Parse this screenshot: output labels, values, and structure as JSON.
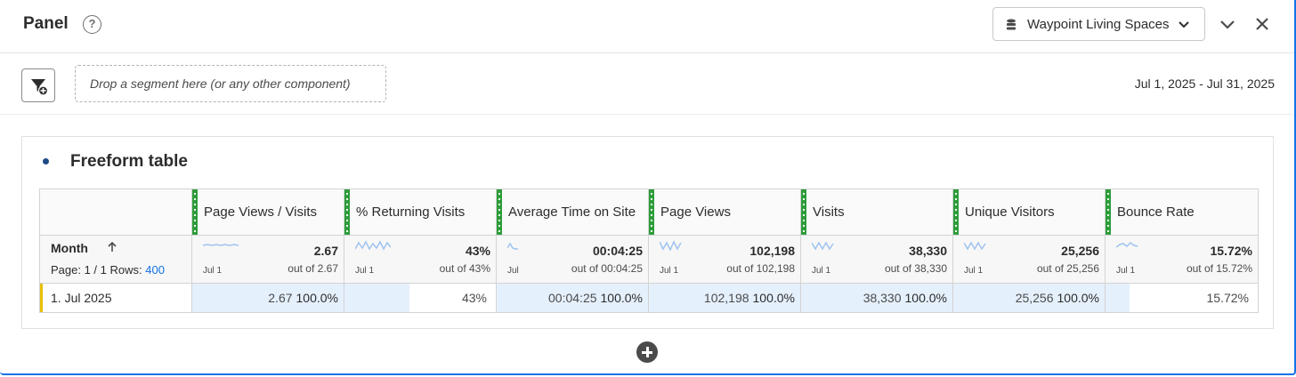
{
  "panel": {
    "title": "Panel",
    "help_glyph": "?",
    "report_suite": "Waypoint Living Spaces"
  },
  "segment_bar": {
    "drop_placeholder": "Drop a segment here (or any other component)",
    "date_range": "Jul 1, 2025 - Jul 31, 2025"
  },
  "freeform": {
    "title": "Freeform table",
    "dimension": "Month",
    "page_label": "Page: 1 / 1",
    "rows_label": "Rows:",
    "rows_value": "400",
    "columns": [
      {
        "label": "Page Views / Visits",
        "total": "2.67",
        "out_of": "out of 2.67",
        "spark_label": "Jul 1",
        "row_value": "2.67",
        "row_pct": "100.0%",
        "bar_fraction": 1.0
      },
      {
        "label": "% Returning Visits",
        "total": "43%",
        "out_of": "out of 43%",
        "spark_label": "Jul 1",
        "row_value": "43%",
        "row_pct": "",
        "bar_fraction": 0.43
      },
      {
        "label": "Average Time on Site",
        "total": "00:04:25",
        "out_of": "out of 00:04:25",
        "spark_label": "Jul",
        "row_value": "00:04:25",
        "row_pct": "100.0%",
        "bar_fraction": 1.0
      },
      {
        "label": "Page Views",
        "total": "102,198",
        "out_of": "out of 102,198",
        "spark_label": "Jul 1",
        "row_value": "102,198",
        "row_pct": "100.0%",
        "bar_fraction": 1.0
      },
      {
        "label": "Visits",
        "total": "38,330",
        "out_of": "out of 38,330",
        "spark_label": "Jul 1",
        "row_value": "38,330",
        "row_pct": "100.0%",
        "bar_fraction": 1.0
      },
      {
        "label": "Unique Visitors",
        "total": "25,256",
        "out_of": "out of 25,256",
        "spark_label": "Jul 1",
        "row_value": "25,256",
        "row_pct": "100.0%",
        "bar_fraction": 1.0
      },
      {
        "label": "Bounce Rate",
        "total": "15.72%",
        "out_of": "out of 15.72%",
        "spark_label": "Jul 1",
        "row_value": "15.72%",
        "row_pct": "",
        "bar_fraction": 0.1572
      }
    ],
    "rows": [
      {
        "label": "1.  Jul 2025"
      }
    ]
  },
  "colors": {
    "accent": "#1473e6",
    "column_grip": "#2d9d3a",
    "bar_fill": "#e5f0fd",
    "row_marker": "#e8c100",
    "sparkline": "#9ec3f0"
  },
  "icons": {
    "help": "help-icon",
    "report_suite": "database-icon",
    "dropdown": "chevron-down-icon",
    "collapse": "chevron-down-icon",
    "close": "close-icon",
    "segment_filter": "filter-add-icon",
    "sort": "sort-ascending-icon",
    "add_visualization": "add-circle-icon"
  }
}
